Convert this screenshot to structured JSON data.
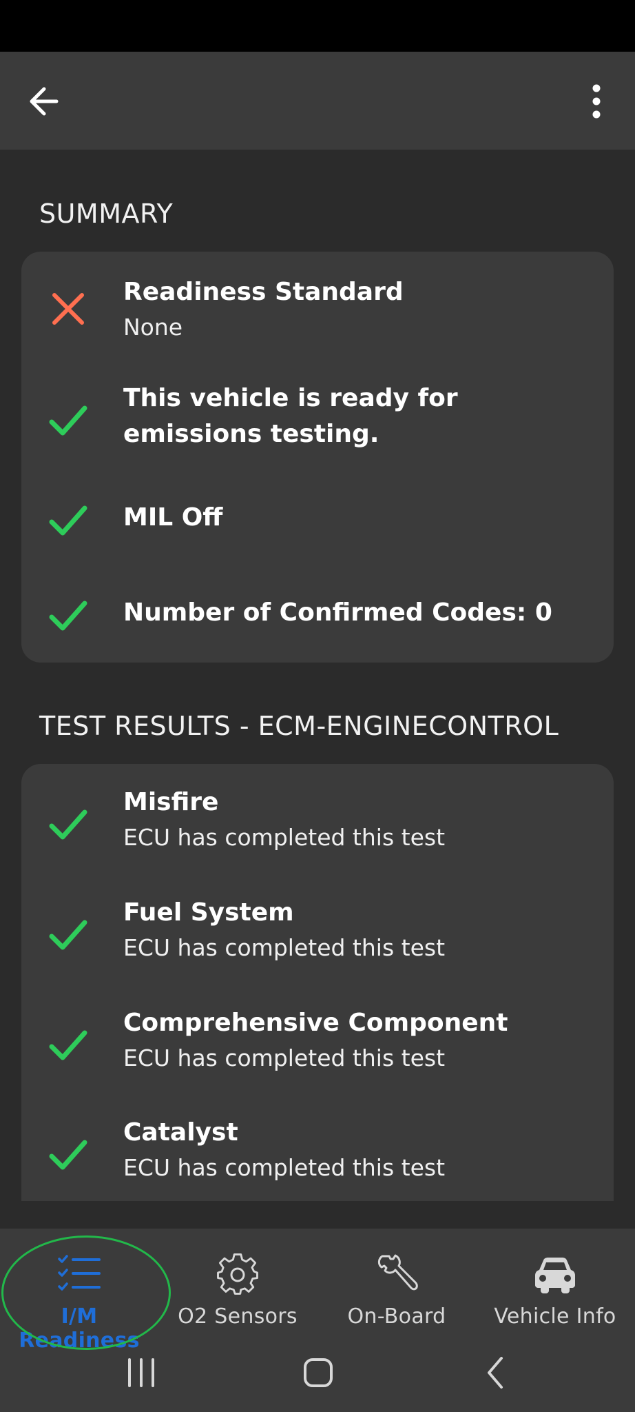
{
  "colors": {
    "accent": "#1f6ed8",
    "success": "#2ecc5a",
    "error": "#ff6f50",
    "card": "#3b3b3b",
    "background": "#2b2b2b"
  },
  "summary": {
    "heading": "SUMMARY",
    "items": [
      {
        "icon": "x-icon",
        "status": "fail",
        "title": "Readiness Standard",
        "subtitle": "None"
      },
      {
        "icon": "check-icon",
        "status": "pass",
        "title": "This vehicle is ready for emissions testing.",
        "subtitle": ""
      },
      {
        "icon": "check-icon",
        "status": "pass",
        "title": "MIL Off",
        "subtitle": ""
      },
      {
        "icon": "check-icon",
        "status": "pass",
        "title": "Number of Confirmed Codes: 0",
        "subtitle": ""
      }
    ]
  },
  "test_results": {
    "heading": "TEST RESULTS - ECM-ENGINECONTROL",
    "items": [
      {
        "icon": "check-icon",
        "status": "pass",
        "title": "Misfire",
        "subtitle": "ECU has completed this test"
      },
      {
        "icon": "check-icon",
        "status": "pass",
        "title": "Fuel System",
        "subtitle": "ECU has completed this test"
      },
      {
        "icon": "check-icon",
        "status": "pass",
        "title": "Comprehensive Component",
        "subtitle": "ECU has completed this test"
      },
      {
        "icon": "check-icon",
        "status": "pass",
        "title": "Catalyst",
        "subtitle": "ECU has completed this test"
      }
    ]
  },
  "bottom_nav": {
    "items": [
      {
        "label": "I/M Readiness",
        "icon": "checklist-icon",
        "active": true
      },
      {
        "label": "O2 Sensors",
        "icon": "gear-icon",
        "active": false
      },
      {
        "label": "On-Board",
        "icon": "wrench-icon",
        "active": false
      },
      {
        "label": "Vehicle Info",
        "icon": "car-icon",
        "active": false
      }
    ]
  },
  "system_nav": {
    "items": [
      {
        "icon": "recents-icon"
      },
      {
        "icon": "home-icon"
      },
      {
        "icon": "back-icon"
      }
    ]
  }
}
